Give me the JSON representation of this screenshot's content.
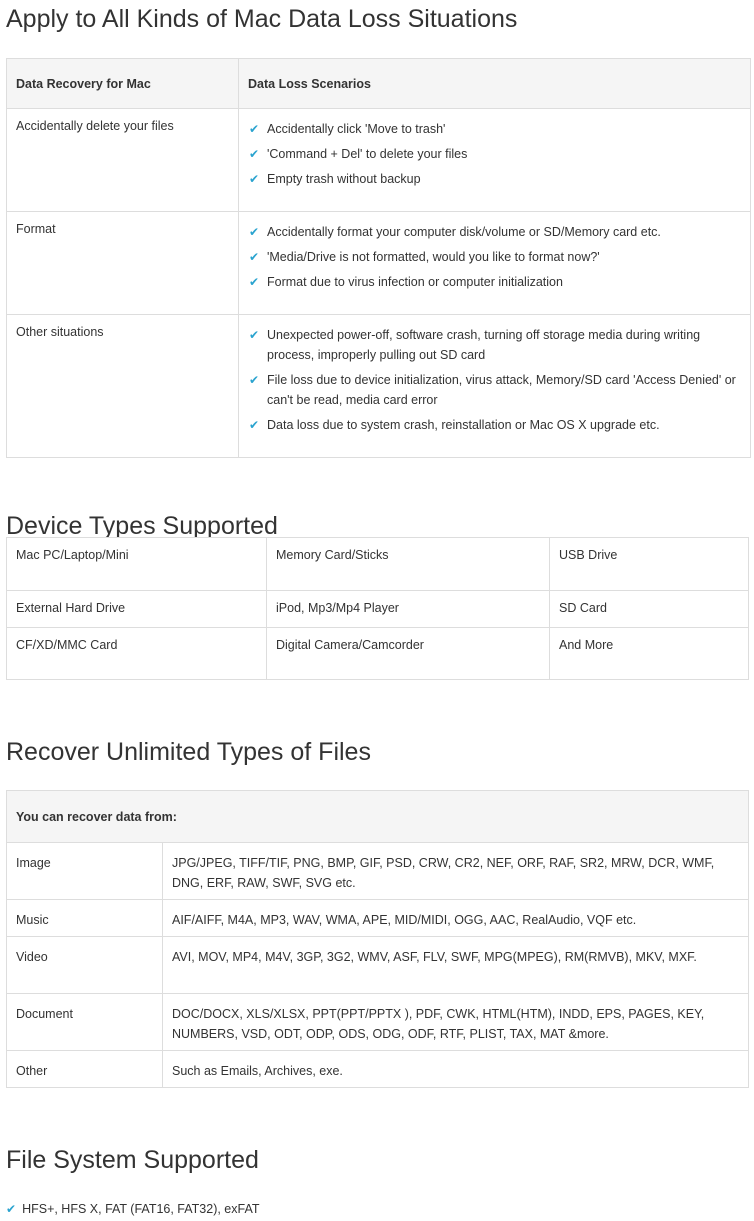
{
  "section1": {
    "title": "Apply to All Kinds of Mac Data Loss Situations",
    "headers": [
      "Data Recovery for Mac",
      "Data Loss Scenarios"
    ],
    "rows": [
      {
        "label": "Accidentally delete your files",
        "items": [
          "Accidentally click 'Move to trash'",
          "'Command + Del' to delete your files",
          "Empty trash without backup"
        ]
      },
      {
        "label": "Format",
        "items": [
          "Accidentally format your computer disk/volume or SD/Memory card etc.",
          "'Media/Drive is not formatted, would you like to format now?'",
          "Format due to virus infection or computer initialization"
        ]
      },
      {
        "label": "Other situations",
        "items": [
          "Unexpected power-off, software crash, turning off storage media during writing process, improperly pulling out SD card",
          "File loss due to device initialization, virus attack, Memory/SD card 'Access Denied' or can't be read, media card error",
          "Data loss due to system crash, reinstallation or Mac OS X upgrade etc."
        ]
      }
    ]
  },
  "section2": {
    "title": "Device Types Supported",
    "rows": [
      [
        "Mac PC/Laptop/Mini",
        "Memory Card/Sticks",
        "USB Drive"
      ],
      [
        "External Hard Drive",
        "iPod, Mp3/Mp4 Player",
        "SD Card"
      ],
      [
        "CF/XD/MMC Card",
        "Digital Camera/Camcorder",
        "And More"
      ]
    ]
  },
  "section3": {
    "title": "Recover Unlimited Types of Files",
    "header": "You can recover data from:",
    "rows": [
      {
        "type": "Image",
        "formats": "JPG/JPEG, TIFF/TIF, PNG, BMP, GIF, PSD, CRW, CR2, NEF, ORF, RAF, SR2, MRW, DCR, WMF, DNG, ERF, RAW, SWF, SVG etc."
      },
      {
        "type": "Music",
        "formats": "AIF/AIFF, M4A, MP3, WAV, WMA, APE, MID/MIDI, OGG, AAC, RealAudio, VQF etc."
      },
      {
        "type": "Video",
        "formats": "AVI, MOV, MP4, M4V, 3GP, 3G2, WMV, ASF, FLV, SWF, MPG(MPEG), RM(RMVB), MKV, MXF."
      },
      {
        "type": "Document",
        "formats": "DOC/DOCX, XLS/XLSX, PPT(PPT/PPTX ), PDF, CWK, HTML(HTM), INDD, EPS, PAGES, KEY, NUMBERS, VSD, ODT, ODP, ODS, ODG, ODF, RTF, PLIST, TAX, MAT &more."
      },
      {
        "type": "Other",
        "formats": "Such as Emails, Archives, exe."
      }
    ]
  },
  "section4": {
    "title": "File System Supported",
    "items": [
      "HFS+, HFS X, FAT (FAT16, FAT32), exFAT"
    ]
  },
  "colors": {
    "check": "#2aa3cf",
    "border": "#dddddd",
    "header_bg": "#f5f5f5"
  },
  "icons": {
    "check": "check-icon"
  }
}
